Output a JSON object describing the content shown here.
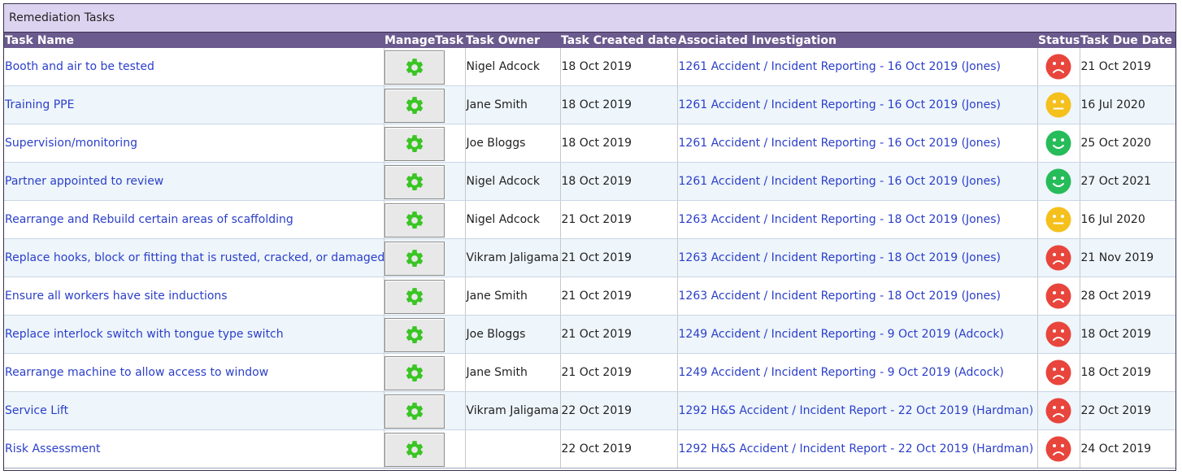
{
  "panel": {
    "title": "Remediation Tasks"
  },
  "columns": {
    "task_name": "Task Name",
    "manage_task": "ManageTask",
    "task_owner": "Task Owner",
    "created": "Task Created date",
    "investigation": "Associated Investigation",
    "status": "Status",
    "due": "Task Due Date"
  },
  "status_colors": {
    "red": "#e8453c",
    "yellow": "#f5c01c",
    "green": "#27bc5a"
  },
  "icons": {
    "manage": "gear-icon"
  },
  "rows": [
    {
      "name": "Booth and air to be tested",
      "owner": "Nigel Adcock",
      "created": "18 Oct 2019",
      "investigation": "1261 Accident / Incident Reporting - 16 Oct 2019 (Jones)",
      "status": "red",
      "due": "21 Oct 2019"
    },
    {
      "name": "Training PPE",
      "owner": "Jane Smith",
      "created": "18 Oct 2019",
      "investigation": "1261 Accident / Incident Reporting - 16 Oct 2019 (Jones)",
      "status": "yellow",
      "due": "16 Jul 2020"
    },
    {
      "name": "Supervision/monitoring",
      "owner": "Joe Bloggs",
      "created": "18 Oct 2019",
      "investigation": "1261 Accident / Incident Reporting - 16 Oct 2019 (Jones)",
      "status": "green",
      "due": "25 Oct 2020"
    },
    {
      "name": "Partner appointed to review",
      "owner": "Nigel Adcock",
      "created": "18 Oct 2019",
      "investigation": "1261 Accident / Incident Reporting - 16 Oct 2019 (Jones)",
      "status": "green",
      "due": "27 Oct 2021"
    },
    {
      "name": "Rearrange and Rebuild certain areas of scaffolding",
      "owner": "Nigel Adcock",
      "created": "21 Oct 2019",
      "investigation": "1263 Accident / Incident Reporting - 18 Oct 2019 (Jones)",
      "status": "yellow",
      "due": "16 Jul 2020"
    },
    {
      "name": "Replace hooks, block or fitting that is rusted, cracked, or damaged",
      "owner": "Vikram Jaligama",
      "created": "21 Oct 2019",
      "investigation": "1263 Accident / Incident Reporting - 18 Oct 2019 (Jones)",
      "status": "red",
      "due": "21 Nov 2019"
    },
    {
      "name": "Ensure all workers have site inductions",
      "owner": "Jane Smith",
      "created": "21 Oct 2019",
      "investigation": "1263 Accident / Incident Reporting - 18 Oct 2019 (Jones)",
      "status": "red",
      "due": "28 Oct 2019"
    },
    {
      "name": "Replace interlock switch with tongue type switch",
      "owner": "Joe Bloggs",
      "created": "21 Oct 2019",
      "investigation": "1249 Accident / Incident Reporting - 9 Oct 2019 (Adcock)",
      "status": "red",
      "due": "18 Oct 2019"
    },
    {
      "name": "Rearrange machine to allow access to window",
      "owner": "Jane Smith",
      "created": "21 Oct 2019",
      "investigation": "1249 Accident / Incident Reporting - 9 Oct 2019 (Adcock)",
      "status": "red",
      "due": "18 Oct 2019"
    },
    {
      "name": "Service Lift",
      "owner": "Vikram Jaligama",
      "created": "22 Oct 2019",
      "investigation": "1292 H&S Accident / Incident Report - 22 Oct 2019 (Hardman)",
      "status": "red",
      "due": "22 Oct 2019"
    },
    {
      "name": "Risk Assessment",
      "owner": "",
      "created": "22 Oct 2019",
      "investigation": "1292 H&S Accident / Incident Report - 22 Oct 2019 (Hardman)",
      "status": "red",
      "due": "24 Oct 2019"
    }
  ]
}
